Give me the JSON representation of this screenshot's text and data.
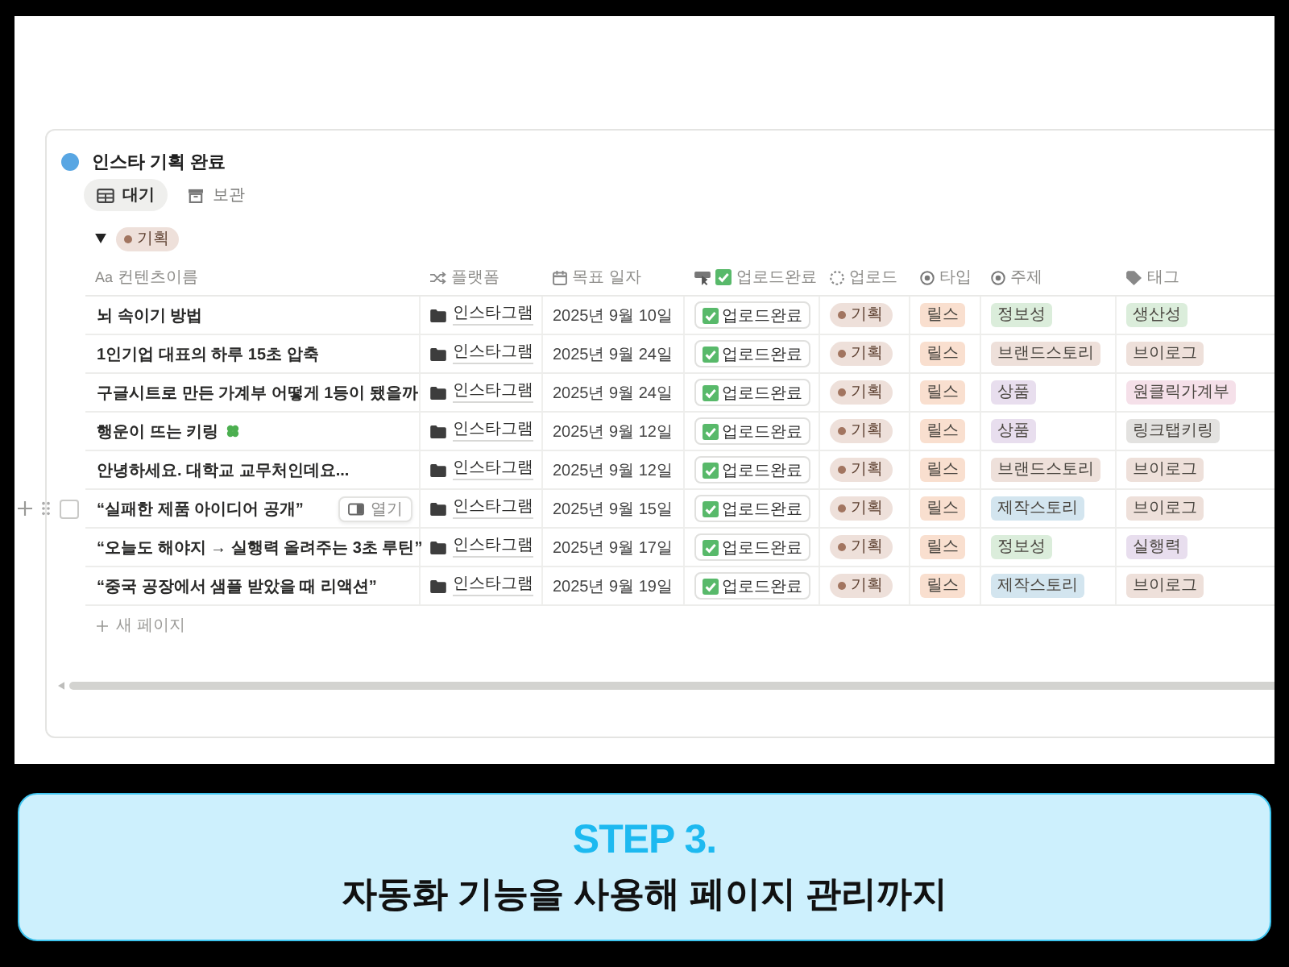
{
  "database": {
    "title": "인스타 기획 완료"
  },
  "views": [
    {
      "label": "대기",
      "selected": true
    },
    {
      "label": "보관",
      "selected": false
    }
  ],
  "group": {
    "label": "기획",
    "expanded": true
  },
  "columns": [
    {
      "kind": "title",
      "prefix": "Aa",
      "label": "컨텐츠이름"
    },
    {
      "kind": "link",
      "label": "플랫폼"
    },
    {
      "kind": "date",
      "label": "목표 일자"
    },
    {
      "kind": "button",
      "label": "업로드완료"
    },
    {
      "kind": "status",
      "label": "업로드"
    },
    {
      "kind": "select",
      "label": "타입"
    },
    {
      "kind": "select",
      "label": "주제"
    },
    {
      "kind": "multi",
      "label": "태그"
    }
  ],
  "rows": [
    {
      "hovered": false,
      "selected": false,
      "has_emoji": false,
      "cells": [
        "뇌 속이기 방법",
        "인스타그램",
        "2025년 9월 10일",
        "업로드완료",
        "기획",
        "릴스",
        {
          "label": "정보성",
          "color": "#dbeddb"
        },
        {
          "label": "생산성",
          "color": "#dbeddb"
        }
      ]
    },
    {
      "hovered": false,
      "selected": false,
      "has_emoji": false,
      "cells": [
        "1인기업 대표의 하루 15초 압축",
        "인스타그램",
        "2025년 9월 24일",
        "업로드완료",
        "기획",
        "릴스",
        {
          "label": "브랜드스토리",
          "color": "#eee0da"
        },
        {
          "label": "브이로그",
          "color": "#eee0da"
        }
      ]
    },
    {
      "hovered": false,
      "selected": false,
      "has_emoji": false,
      "cells": [
        "구글시트로 만든 가계부 어떻게 1등이 됐을까",
        "인스타그램",
        "2025년 9월 24일",
        "업로드완료",
        "기획",
        "릴스",
        {
          "label": "상품",
          "color": "#e8deee"
        },
        {
          "label": "원클릭가계부",
          "color": "#f5e0e9"
        }
      ]
    },
    {
      "hovered": false,
      "selected": false,
      "has_emoji": true,
      "cells": [
        "행운이 뜨는 키링",
        "인스타그램",
        "2025년 9월 12일",
        "업로드완료",
        "기획",
        "릴스",
        {
          "label": "상품",
          "color": "#e8deee"
        },
        {
          "label": "링크탭키링",
          "color": "#e3e2e0"
        }
      ]
    },
    {
      "hovered": false,
      "selected": false,
      "has_emoji": false,
      "cells": [
        "안녕하세요. 대학교 교무처인데요...",
        "인스타그램",
        "2025년 9월 12일",
        "업로드완료",
        "기획",
        "릴스",
        {
          "label": "브랜드스토리",
          "color": "#eee0da"
        },
        {
          "label": "브이로그",
          "color": "#eee0da"
        }
      ]
    },
    {
      "hovered": true,
      "selected": false,
      "has_emoji": false,
      "open_button": "열기",
      "cells": [
        "“실패한 제품 아이디어 공개”",
        "인스타그램",
        "2025년 9월 15일",
        "업로드완료",
        "기획",
        "릴스",
        {
          "label": "제작스토리",
          "color": "#d3e5ef"
        },
        {
          "label": "브이로그",
          "color": "#eee0da"
        }
      ]
    },
    {
      "hovered": false,
      "selected": false,
      "has_emoji": false,
      "cells": [
        "“오늘도 해야지 → 실행력 올려주는 3초 루틴”",
        "인스타그램",
        "2025년 9월 17일",
        "업로드완료",
        "기획",
        "릴스",
        {
          "label": "정보성",
          "color": "#dbeddb"
        },
        {
          "label": "실행력",
          "color": "#e8deee"
        }
      ]
    },
    {
      "hovered": false,
      "selected": false,
      "has_emoji": false,
      "cells": [
        "“중국 공장에서 샘플 받았을 때 리액션”",
        "인스타그램",
        "2025년 9월 19일",
        "업로드완료",
        "기획",
        "릴스",
        {
          "label": "제작스토리",
          "color": "#d3e5ef"
        },
        {
          "label": "브이로그",
          "color": "#eee0da"
        }
      ]
    }
  ],
  "new_page": "새 페이지",
  "caption": {
    "step": "STEP 3.",
    "text": "자동화 기능을 사용해 페이지 관리까지"
  }
}
